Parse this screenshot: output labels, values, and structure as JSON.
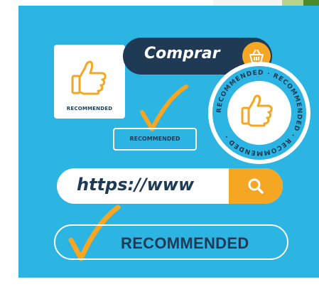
{
  "colors": {
    "background": "#2cb4e3",
    "navy": "#1e3a55",
    "orange": "#f5a623",
    "white": "#ffffff"
  },
  "thumb_card": {
    "caption": "RECOMMENDED"
  },
  "comprar_button": {
    "label": "Comprar",
    "icon": "basket-icon"
  },
  "recommended_box": {
    "label": "RECOMMENDED"
  },
  "badge": {
    "ring_text": "RECOMMENDED · RECOMMENDED · RECOMMENDED ·",
    "icon": "thumbs-up-icon"
  },
  "url_bar": {
    "url": "https://www",
    "icon": "search-icon"
  },
  "recommended_pill": {
    "label": "RECOMMENDED"
  }
}
